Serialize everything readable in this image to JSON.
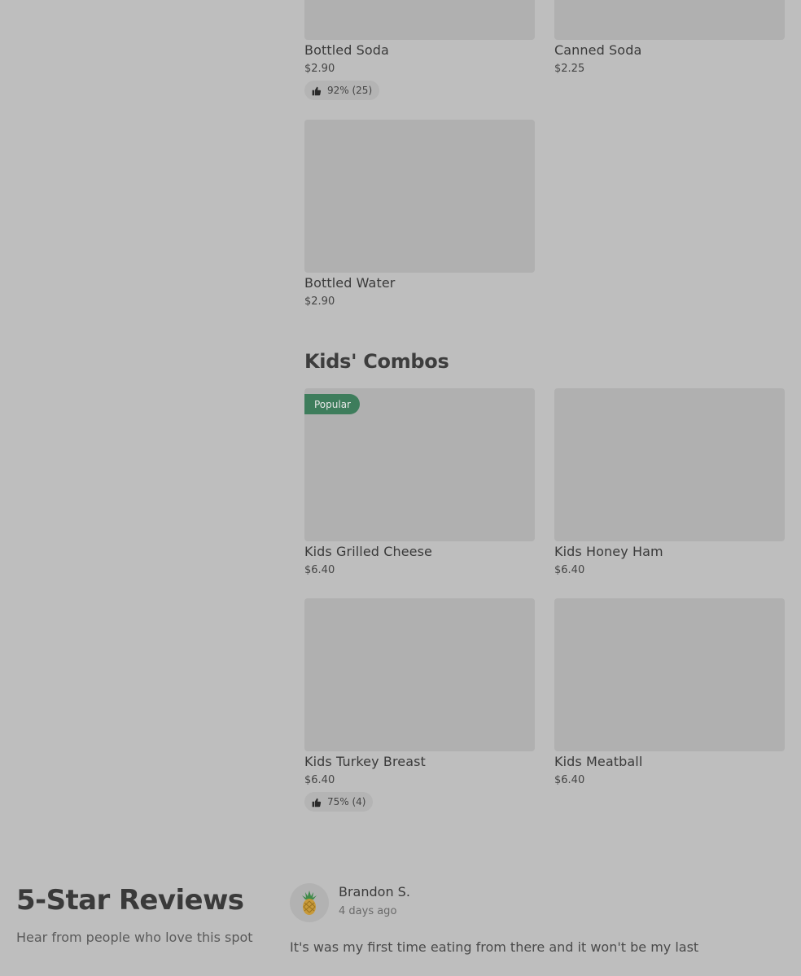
{
  "drinks": [
    {
      "name": "Bottled Soda",
      "price": "$2.90",
      "rating": "92% (25)"
    },
    {
      "name": "Canned Soda",
      "price": "$2.25"
    },
    {
      "name": "Bottled Water",
      "price": "$2.90"
    }
  ],
  "kids_combos": {
    "title": "Kids' Combos",
    "popular_label": "Popular",
    "items": [
      {
        "name": "Kids Grilled Cheese",
        "price": "$6.40"
      },
      {
        "name": "Kids Honey Ham",
        "price": "$6.40"
      },
      {
        "name": "Kids Turkey Breast",
        "price": "$6.40",
        "rating": "75% (4)"
      },
      {
        "name": "Kids Meatball",
        "price": "$6.40"
      }
    ]
  },
  "reviews": {
    "title": "5-Star Reviews",
    "subtitle": "Hear from people who love this spot",
    "items": [
      {
        "avatar_icon": "pineapple-icon",
        "name": "Brandon S.",
        "time": "4 days ago",
        "text": "It's was my first time eating from there and it won't be my last"
      }
    ]
  },
  "colors": {
    "background": "#bebebe",
    "placeholder": "#b0b0b0",
    "popular_badge": "#3e7d5c"
  }
}
